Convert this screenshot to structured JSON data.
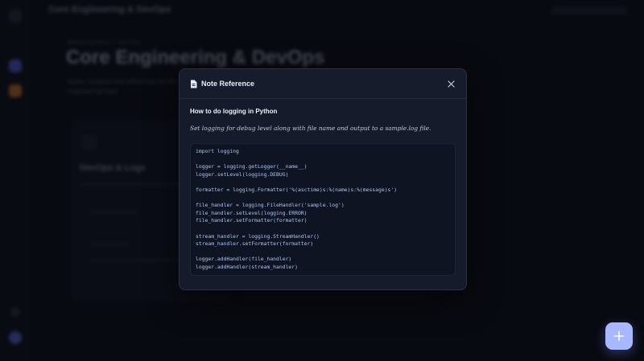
{
  "background": {
    "app_title": "Core Engineering & DevOps",
    "breadcrumb": "WORKSPACE / NOTES",
    "page_title": "Core Engineering & DevOps",
    "page_description": "Notes, snippets and references for the core engineering team.",
    "card_title": "DevOps & Logs"
  },
  "modal": {
    "title": "Note Reference",
    "close_icon": "close-icon",
    "header_icon": "document-icon",
    "note_title": "How to do logging in Python",
    "note_description": "Set logging for debug level along with file name and output to a sample.log file.",
    "code_lines": [
      "import logging",
      "",
      "logger = logging.getLogger(__name__)",
      "logger.setLevel(logging.DEBUG)",
      "",
      "formatter = logging.Formatter('%(asctime)s:%(name)s:%(message)s')",
      "",
      "file_handler = logging.FileHandler('sample.log')",
      "file_handler.setLevel(logging.ERROR)",
      "file_handler.setFormatter(formatter)",
      "",
      "stream_handler = logging.StreamHandler()",
      "stream_handler.setFormatter(formatter)",
      "",
      "logger.addHandler(file_handler)",
      "logger.addHandler(stream_handler)"
    ]
  },
  "fab": {
    "icon": "plus-icon"
  },
  "colors": {
    "accent": "#a7b8ff",
    "modal_bg": "#151b2b",
    "code_text": "#a9c6f0"
  }
}
